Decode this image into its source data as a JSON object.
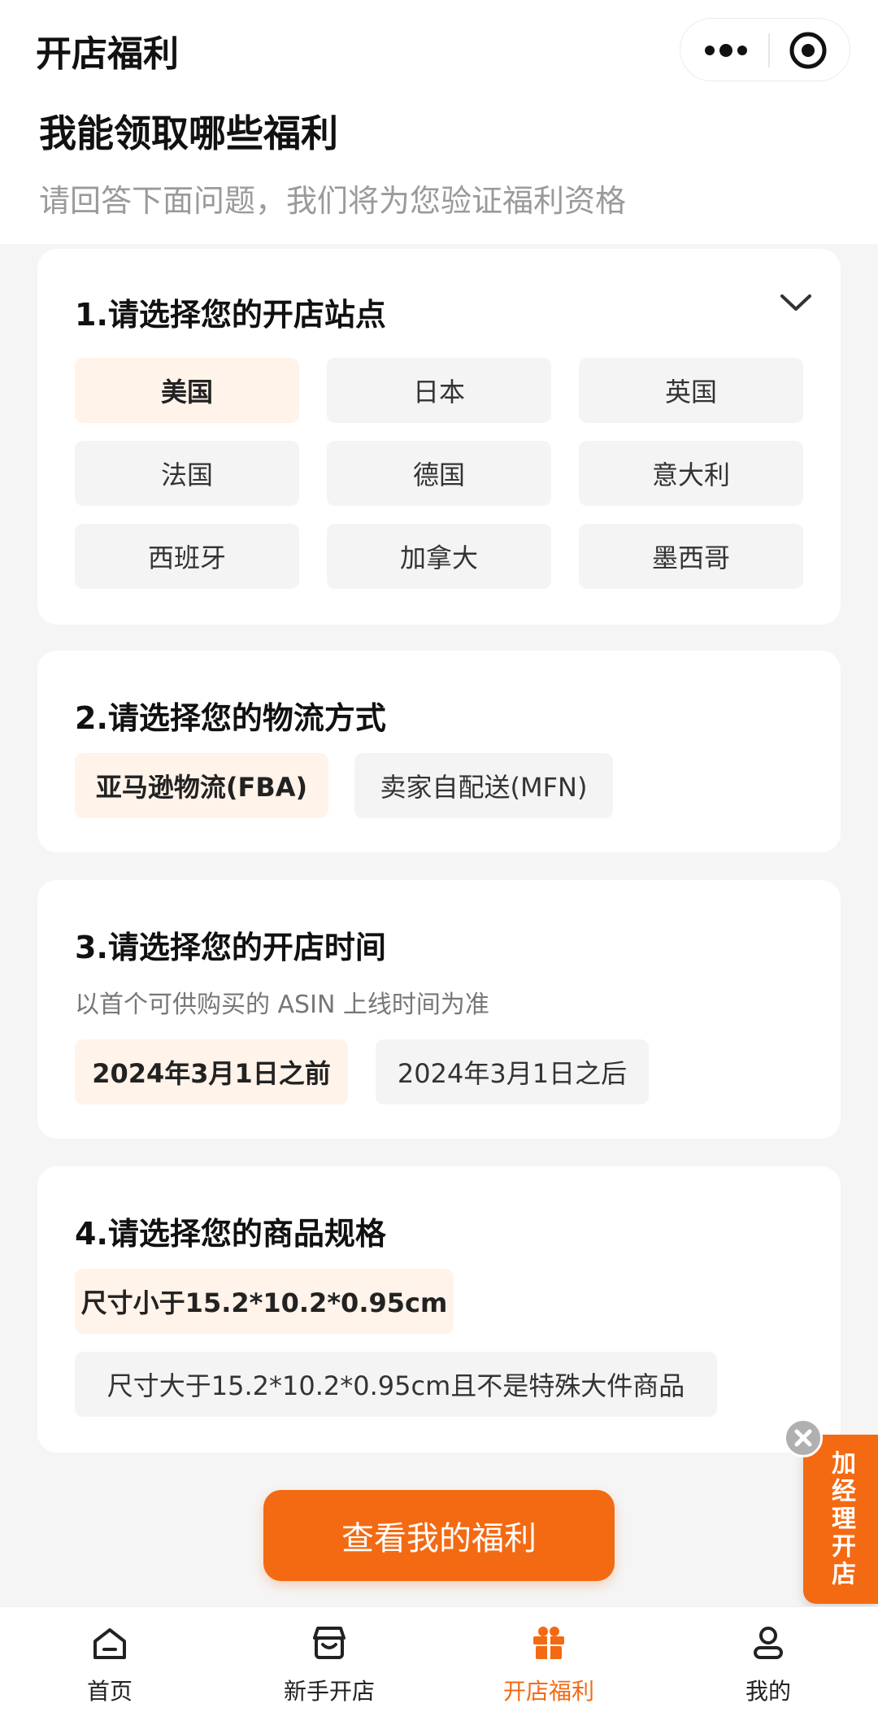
{
  "header": {
    "title": "开店福利",
    "more_icon": "more-dots-icon",
    "target_icon": "target-icon"
  },
  "intro": {
    "title": "我能领取哪些福利",
    "subtitle": "请回答下面问题，我们将为您验证福利资格"
  },
  "questions": {
    "q1": {
      "title": "1.请选择您的开店站点",
      "options": [
        "美国",
        "日本",
        "英国",
        "法国",
        "德国",
        "意大利",
        "西班牙",
        "加拿大",
        "墨西哥"
      ],
      "selected": "美国"
    },
    "q2": {
      "title": "2.请选择您的物流方式",
      "options": [
        "亚马逊物流(FBA)",
        "卖家自配送(MFN)"
      ],
      "selected": "亚马逊物流(FBA)"
    },
    "q3": {
      "title": "3.请选择您的开店时间",
      "hint": "以首个可供购买的 ASIN 上线时间为准",
      "options": [
        "2024年3月1日之前",
        "2024年3月1日之后"
      ],
      "selected": "2024年3月1日之前"
    },
    "q4": {
      "title": "4.请选择您的商品规格",
      "options": [
        "尺寸小于15.2*10.2*0.95cm",
        "尺寸大于15.2*10.2*0.95cm且不是特殊大件商品"
      ],
      "selected": "尺寸小于15.2*10.2*0.95cm"
    }
  },
  "cta": {
    "label": "查看我的福利"
  },
  "floating": {
    "label": "加经理开店"
  },
  "tabbar": {
    "items": [
      {
        "label": "首页",
        "icon": "home-icon"
      },
      {
        "label": "新手开店",
        "icon": "shop-icon"
      },
      {
        "label": "开店福利",
        "icon": "gift-icon",
        "active": true
      },
      {
        "label": "我的",
        "icon": "user-icon"
      }
    ]
  },
  "colors": {
    "accent": "#f36a13",
    "selected_bg": "#fff3ea",
    "option_bg": "#f4f4f4"
  }
}
